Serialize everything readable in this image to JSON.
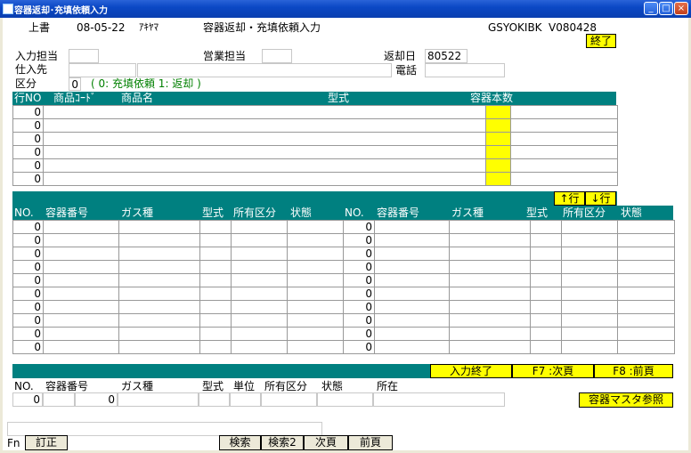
{
  "window": {
    "title": "容器返却･充填依頼入力"
  },
  "header": {
    "mode": "上書",
    "date": "08-05-22",
    "user": "ｱｷﾔﾏ",
    "screen_title": "容器返却・充填依頼入力",
    "program_id": "GSYOKIBK",
    "version": "V080428",
    "end_button": "終了"
  },
  "form": {
    "input_staff_label": "入力担当",
    "sales_staff_label": "営業担当",
    "return_date_label": "返却日",
    "return_date_value": "80522",
    "supplier_label": "仕入先",
    "phone_label": "電話",
    "category_label": "区分",
    "category_value": "0",
    "category_hint": "( 0: 充填依頼  1: 返却 )"
  },
  "product_table": {
    "headers": [
      "行NO",
      "商品ｺｰﾄﾞ",
      "商品名",
      "型式",
      "容器本数"
    ],
    "rows": [
      "0",
      "0",
      "0",
      "0",
      "0",
      "0"
    ],
    "row_up": "↑行",
    "row_down": "↓行"
  },
  "container_table": {
    "headers": [
      "NO.",
      "容器番号",
      "ガス種",
      "型式",
      "所有区分",
      "状態"
    ],
    "left_rows": [
      "0",
      "0",
      "0",
      "0",
      "0",
      "0",
      "0",
      "0",
      "0",
      "0"
    ],
    "right_rows": [
      "0",
      "0",
      "0",
      "0",
      "0",
      "0",
      "0",
      "0",
      "0",
      "0"
    ],
    "input_end": "入力終了",
    "next_page": "F7 :次頁",
    "prev_page": "F8 :前頁"
  },
  "entry_row": {
    "headers": [
      "NO.",
      "容器番号",
      "ガス種",
      "型式",
      "単位",
      "所有区分",
      "状態",
      "所在"
    ],
    "no_value": "0",
    "count_value": "0",
    "master_button": "容器マスタ参照"
  },
  "function_keys": {
    "fn_label": "Fn",
    "correct": "訂正",
    "search": "検索",
    "search2": "検索2",
    "next": "次頁",
    "prev": "前頁"
  }
}
